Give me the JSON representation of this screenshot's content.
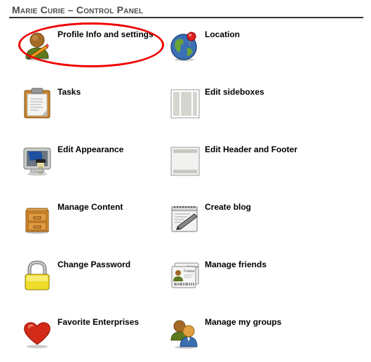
{
  "header": {
    "title": "Marie Curie – Control Panel"
  },
  "annotation": {
    "highlighted_item": "Profile Info and settings",
    "color": "#e00000"
  },
  "items": [
    {
      "label": "Profile Info and settings",
      "icon": "user-edit-icon"
    },
    {
      "label": "Location",
      "icon": "globe-pin-icon"
    },
    {
      "label": "Tasks",
      "icon": "clipboard-icon"
    },
    {
      "label": "Edit sideboxes",
      "icon": "sideboxes-layout-icon"
    },
    {
      "label": "Edit Appearance",
      "icon": "monitor-paint-icon"
    },
    {
      "label": "Edit Header and Footer",
      "icon": "header-footer-layout-icon"
    },
    {
      "label": "Manage Content",
      "icon": "file-cabinet-icon"
    },
    {
      "label": "Create blog",
      "icon": "notepad-pen-icon"
    },
    {
      "label": "Change Password",
      "icon": "padlock-icon"
    },
    {
      "label": "Manage friends",
      "icon": "contact-cards-icon",
      "card_name": "Fulana"
    },
    {
      "label": "Favorite Enterprises",
      "icon": "heart-icon"
    },
    {
      "label": "Manage my groups",
      "icon": "user-group-icon"
    }
  ]
}
